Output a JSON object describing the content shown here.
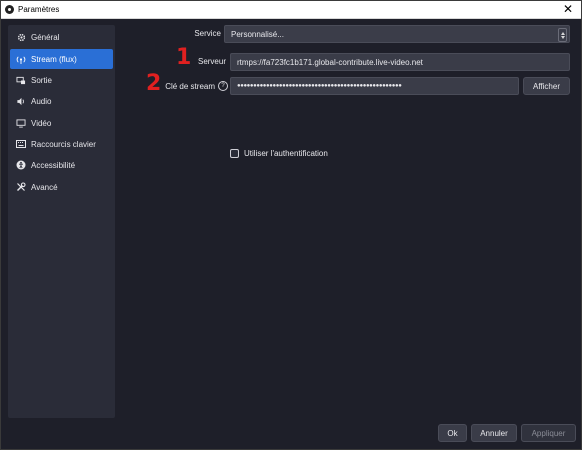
{
  "window": {
    "title": "Paramètres",
    "close_glyph": "✕"
  },
  "sidebar": {
    "items": [
      {
        "label": "Général",
        "icon": "gear-icon",
        "active": false
      },
      {
        "label": "Stream (flux)",
        "icon": "antenna-icon",
        "active": true
      },
      {
        "label": "Sortie",
        "icon": "output-icon",
        "active": false
      },
      {
        "label": "Audio",
        "icon": "speaker-icon",
        "active": false
      },
      {
        "label": "Vidéo",
        "icon": "monitor-icon",
        "active": false
      },
      {
        "label": "Raccourcis clavier",
        "icon": "keyboard-icon",
        "active": false
      },
      {
        "label": "Accessibilité",
        "icon": "accessibility-icon",
        "active": false
      },
      {
        "label": "Avancé",
        "icon": "tools-icon",
        "active": false
      }
    ]
  },
  "stream": {
    "service_label": "Service",
    "service_value": "Personnalisé...",
    "server_label": "Serveur",
    "server_value": "rtmps://fa723fc1b171.global-contribute.live-video.net",
    "key_label": "Clé de stream",
    "key_help": "?",
    "key_value": "●●●●●●●●●●●●●●●●●●●●●●●●●●●●●●●●●●●●●●●●●●●●●●●●●●●",
    "show_button": "Afficher",
    "auth_label": "Utiliser l'authentification",
    "auth_checked": false
  },
  "annotations": {
    "marker_1": "1",
    "marker_2": "2"
  },
  "footer": {
    "ok": "Ok",
    "cancel": "Annuler",
    "apply": "Appliquer"
  },
  "colors": {
    "accent": "#2a6fd6",
    "marker": "#e02020",
    "background": "#1e1f29"
  }
}
